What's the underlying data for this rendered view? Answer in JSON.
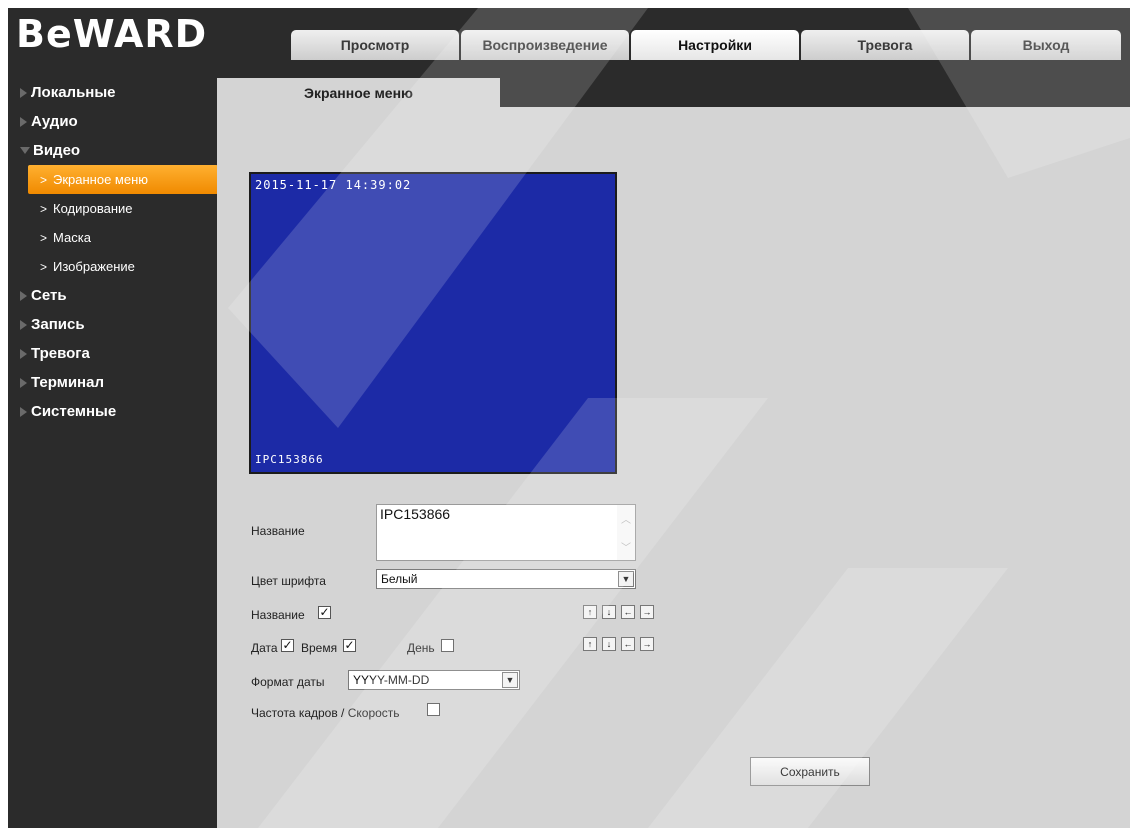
{
  "brand": {
    "logo": "BeWARD"
  },
  "topnav": {
    "tabs": [
      {
        "label": "Просмотр"
      },
      {
        "label": "Воспроизведение"
      },
      {
        "label": "Настройки"
      },
      {
        "label": "Тревога"
      },
      {
        "label": "Выход"
      }
    ],
    "active": "Настройки"
  },
  "sidebar": {
    "items": [
      {
        "label": "Локальные"
      },
      {
        "label": "Аудио"
      },
      {
        "label": "Видео"
      },
      {
        "label": "Сеть"
      },
      {
        "label": "Запись"
      },
      {
        "label": "Тревога"
      },
      {
        "label": "Терминал"
      },
      {
        "label": "Системные"
      }
    ],
    "video_sub": [
      {
        "label": "Экранное меню"
      },
      {
        "label": "Кодирование"
      },
      {
        "label": "Маска"
      },
      {
        "label": "Изображение"
      }
    ],
    "active_color": "#f39200"
  },
  "main": {
    "tab": "Экранное меню",
    "preview": {
      "datetime": "2015-11-17 14:39:02",
      "name": "IPC153866",
      "bg_color": "#1c2aa6"
    },
    "name_label": "Название",
    "name_value": "IPC153866",
    "font_color_label": "Цвет шрифта",
    "font_color_value": "Белый",
    "show_name_label": "Название",
    "show_name_checked": true,
    "date_label": "Дата",
    "date_checked": true,
    "time_label": "Время",
    "time_checked": true,
    "day_label": "День",
    "day_checked": false,
    "date_format_label": "Формат даты",
    "date_format_value": "YYYY-MM-DD",
    "fps_label": "Частота кадров / Скорость",
    "fps_checked": false,
    "arrows": {
      "up": "↑",
      "down": "↓",
      "left": "←",
      "right": "→"
    },
    "save_label": "Сохранить"
  }
}
